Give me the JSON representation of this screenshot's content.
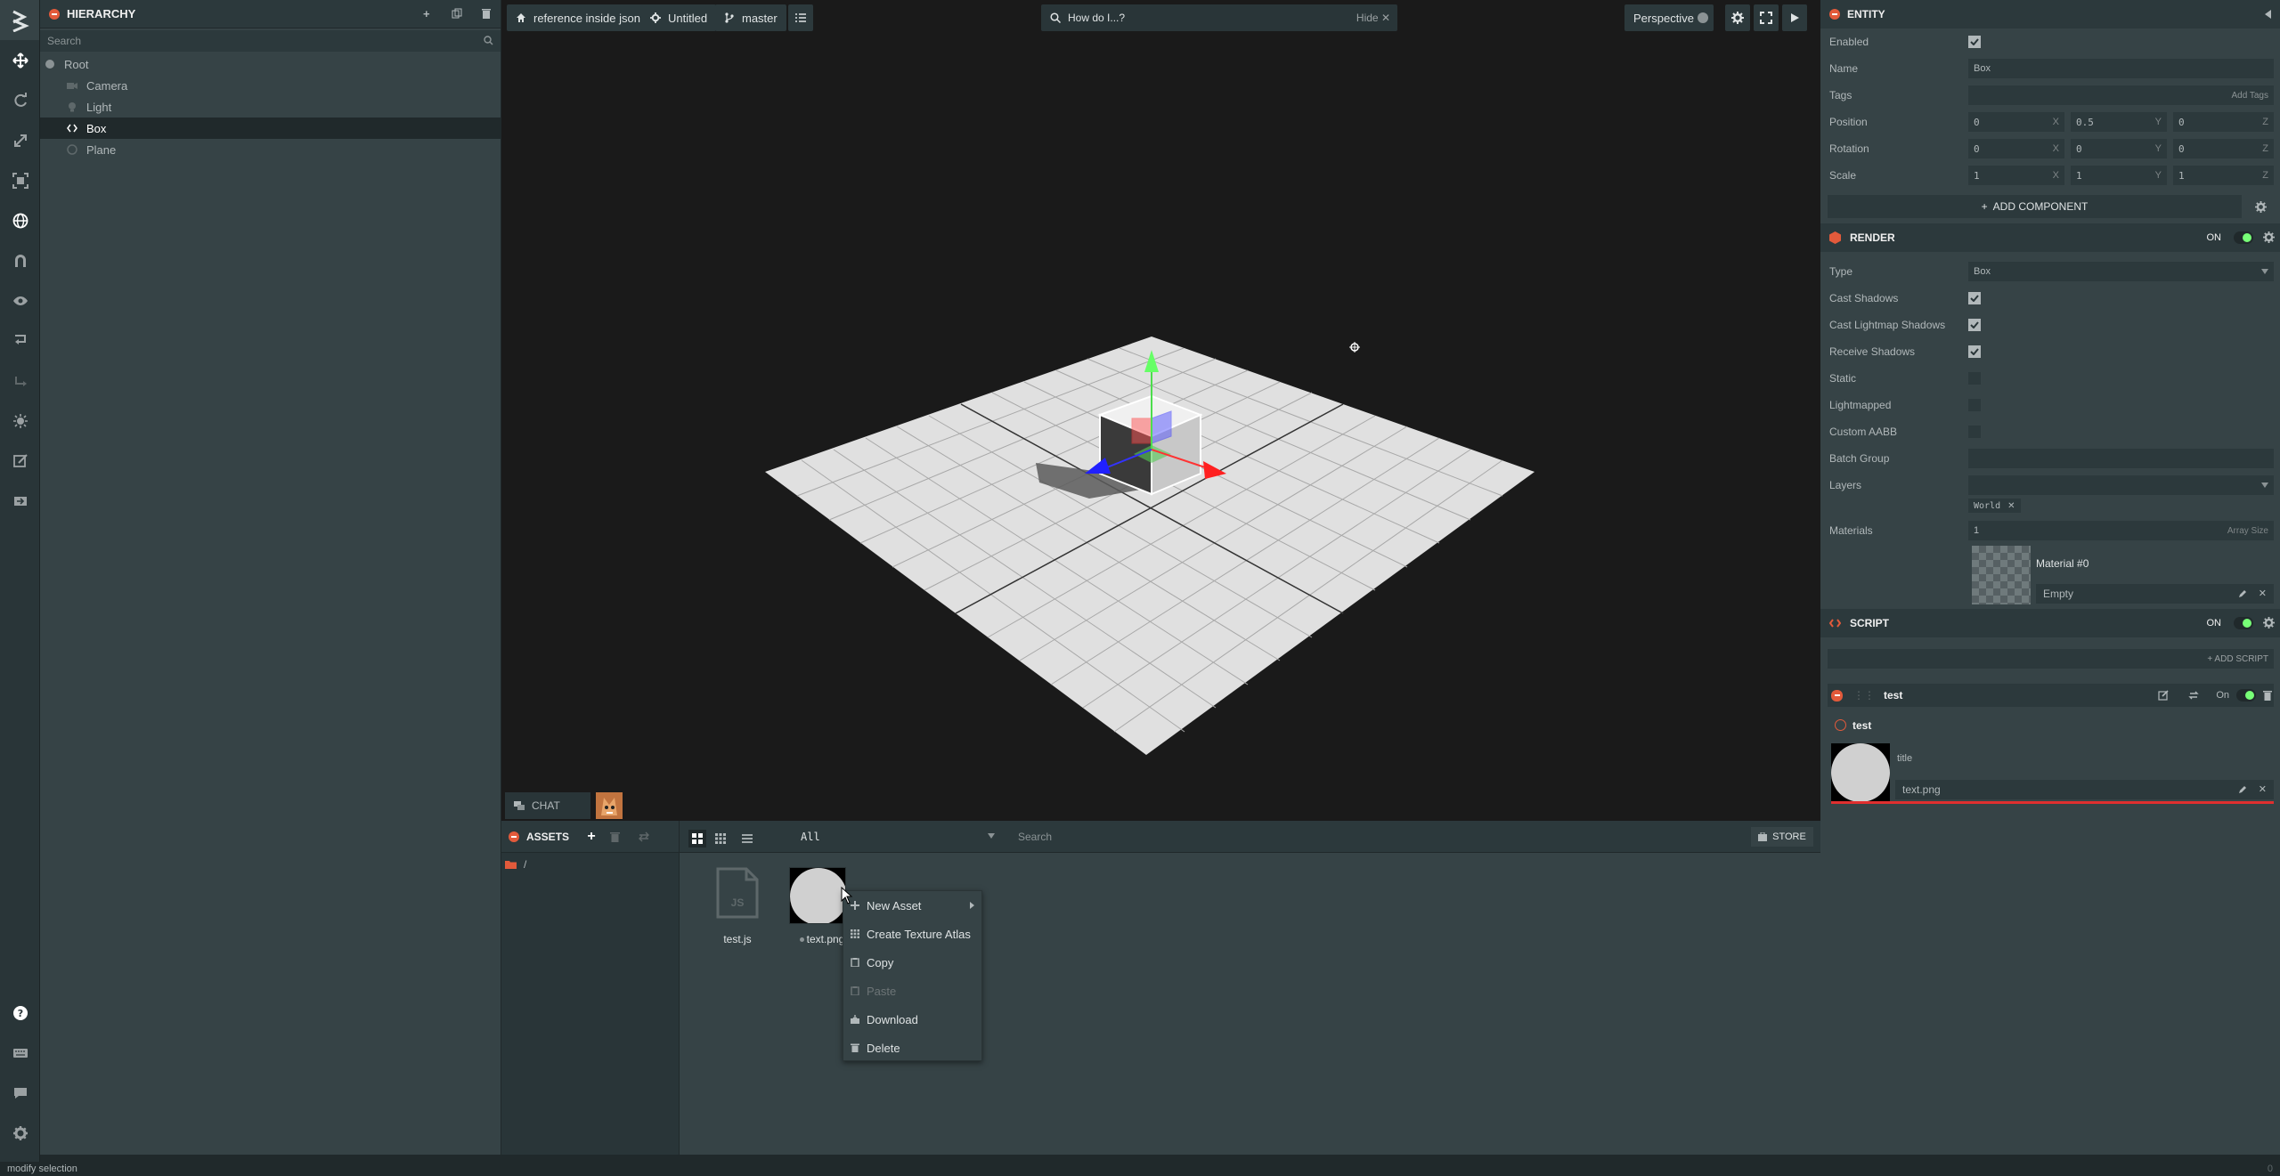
{
  "hierarchy": {
    "title": "HIERARCHY",
    "search_placeholder": "Search",
    "items": [
      {
        "label": "Root"
      },
      {
        "label": "Camera"
      },
      {
        "label": "Light"
      },
      {
        "label": "Box"
      },
      {
        "label": "Plane"
      }
    ]
  },
  "viewport": {
    "project_label": "reference inside json",
    "scene_label": "Untitled",
    "branch_label": "master",
    "help_search_placeholder": "How do I...?",
    "help_hide_label": "Hide",
    "camera_label": "Perspective"
  },
  "chat": {
    "label": "CHAT"
  },
  "assets": {
    "title": "ASSETS",
    "filter_value": "All",
    "search_placeholder": "Search",
    "store_label": "STORE",
    "folder_path": "/",
    "items": [
      {
        "name": "test.js",
        "type_badge": "JS"
      },
      {
        "name": "text.png"
      }
    ]
  },
  "context_menu": {
    "items": [
      {
        "label": "New Asset",
        "icon": "plus-icon",
        "enabled": true
      },
      {
        "label": "Create Texture Atlas",
        "icon": "grid-icon",
        "enabled": true
      },
      {
        "label": "Copy",
        "icon": "copy-icon",
        "enabled": true
      },
      {
        "label": "Paste",
        "icon": "paste-icon",
        "enabled": false
      },
      {
        "label": "Download",
        "icon": "download-icon",
        "enabled": true
      },
      {
        "label": "Delete",
        "icon": "trash-icon",
        "enabled": true
      }
    ]
  },
  "inspector": {
    "entity_title": "ENTITY",
    "enabled_label": "Enabled",
    "name_label": "Name",
    "name_value": "Box",
    "tags_label": "Tags",
    "add_tags_label": "Add Tags",
    "position_label": "Position",
    "position": [
      "0",
      "0.5",
      "0"
    ],
    "rotation_label": "Rotation",
    "rotation": [
      "0",
      "0",
      "0"
    ],
    "scale_label": "Scale",
    "scale": [
      "1",
      "1",
      "1"
    ],
    "axis": [
      "X",
      "Y",
      "Z"
    ],
    "add_component_label": "ADD COMPONENT",
    "render": {
      "title": "RENDER",
      "on_label": "ON",
      "type_label": "Type",
      "type_value": "Box",
      "cast_shadows_label": "Cast Shadows",
      "cast_lightmap_shadows_label": "Cast Lightmap Shadows",
      "receive_shadows_label": "Receive Shadows",
      "static_label": "Static",
      "lightmapped_label": "Lightmapped",
      "custom_aabb_label": "Custom AABB",
      "batch_group_label": "Batch Group",
      "layers_label": "Layers",
      "layer_tag": "World",
      "materials_label": "Materials",
      "materials_count": "1",
      "array_size_label": "Array Size",
      "material_slot_label": "Material #0",
      "material_value": "Empty"
    },
    "script": {
      "title": "SCRIPT",
      "on_label": "ON",
      "add_script_label": "+ ADD SCRIPT",
      "instance_name": "test",
      "instance_on_label": "On",
      "attributes_group": "test",
      "attr_title_label": "title",
      "attr_texture_value": "text.png"
    }
  },
  "status_bar": {
    "text": "modify selection",
    "right_value": "0"
  },
  "colors": {
    "accent": "#e25a3b",
    "toggle_on": "#77ff77",
    "bg": "#364346",
    "viewport_bg": "#1a1a1a"
  }
}
